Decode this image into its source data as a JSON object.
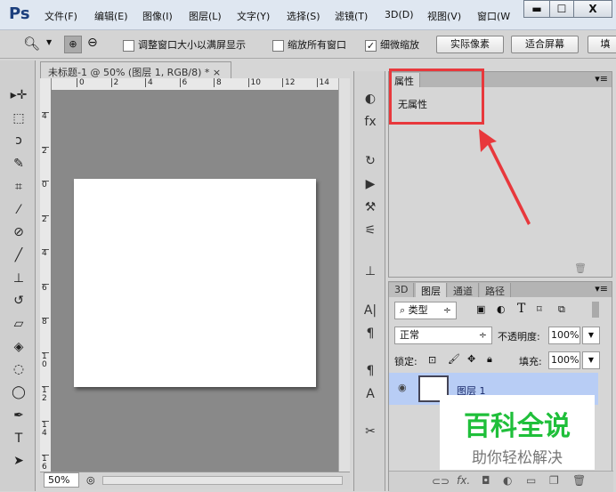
{
  "app": {
    "logo": "Ps"
  },
  "menu": [
    "文件(F)",
    "编辑(E)",
    "图像(I)",
    "图层(L)",
    "文字(Y)",
    "选择(S)",
    "滤镜(T)",
    "3D(D)",
    "视图(V)",
    "窗口(W"
  ],
  "window_controls": {
    "minimize": "▬",
    "maximize": "☐",
    "close": "X"
  },
  "options": {
    "resize_window": "调整窗口大小以满屏显示",
    "zoom_all": "缩放所有窗口",
    "scrubby_zoom": "细微缩放",
    "scrubby_checked": true,
    "actual_pixels": "实际像素",
    "fit_screen": "适合屏幕",
    "fill_screen": "填"
  },
  "toolbox": [
    "move-icon",
    "marquee-icon",
    "lasso-icon",
    "quick-select-icon",
    "crop-icon",
    "eyedropper-icon",
    "healing-icon",
    "brush-icon",
    "stamp-icon",
    "history-brush-icon",
    "eraser-icon",
    "paint-bucket-icon",
    "blur-icon",
    "dodge-icon",
    "pen-icon",
    "type-icon",
    "path-select-icon"
  ],
  "document": {
    "tab": "未标题-1 @ 50% (图层 1, RGB/8) *",
    "close": "×",
    "zoom": "50%",
    "hruler": [
      "0",
      "2",
      "4",
      "6",
      "8",
      "10",
      "12",
      "14"
    ],
    "vruler": [
      "4",
      "2",
      "0",
      "2",
      "4",
      "6",
      "8",
      "10",
      "12",
      "14",
      "16"
    ]
  },
  "properties": {
    "tab": "属性",
    "content": "无属性"
  },
  "layers": {
    "tabs": [
      "3D",
      "图层",
      "通道",
      "路径"
    ],
    "active_tab": "图层",
    "filter": "类型",
    "blend_mode": "正常",
    "opacity_label": "不透明度:",
    "opacity": "100%",
    "lock_label": "锁定:",
    "fill_label": "填充:",
    "fill": "100%",
    "layer_name": "图层 1"
  },
  "watermark": {
    "title": "百科全说",
    "subtitle": "助你轻松解决",
    "color": "#1fbf3a"
  },
  "colors": {
    "annotation_red": "#e8383c",
    "selection": "#b8cdf5"
  }
}
